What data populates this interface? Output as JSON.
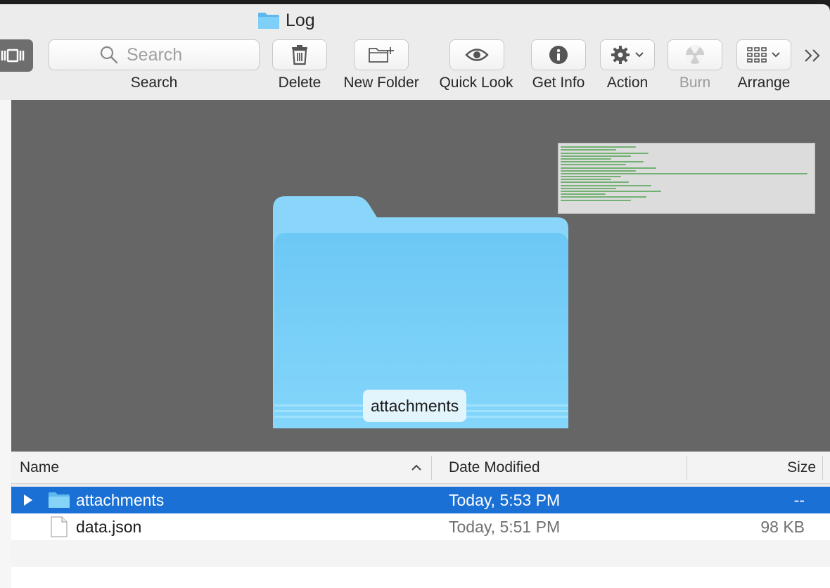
{
  "window": {
    "title": "Log"
  },
  "toolbar": {
    "search": {
      "placeholder": "Search",
      "label": "Search"
    },
    "delete_label": "Delete",
    "new_folder_label": "New Folder",
    "quick_look_label": "Quick Look",
    "get_info_label": "Get Info",
    "action_label": "Action",
    "burn_label": "Burn",
    "arrange_label": "Arrange"
  },
  "preview": {
    "folder_name": "attachments"
  },
  "list": {
    "columns": {
      "name": "Name",
      "date": "Date Modified",
      "size": "Size"
    },
    "rows": [
      {
        "name": "attachments",
        "date": "Today, 5:53 PM",
        "size": "--",
        "kind": "folder",
        "selected": true
      },
      {
        "name": "data.json",
        "date": "Today, 5:51 PM",
        "size": "98 KB",
        "kind": "file",
        "selected": false
      }
    ]
  },
  "colors": {
    "selection": "#1a70d4",
    "folder_blue": "#6cc8f4",
    "preview_bg": "#666666"
  }
}
